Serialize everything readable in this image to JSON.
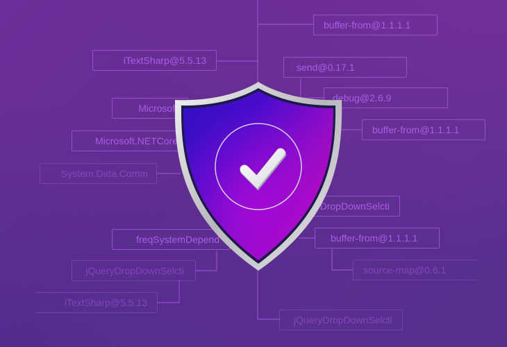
{
  "scene": {
    "description": "Dependency security illustration",
    "colors": {
      "background_top_right": "#7a2f9a",
      "background_bottom_left": "#53308c",
      "node_stroke": "#a95ae6",
      "node_text": "#af5feb",
      "shield_blue": "#3a10c8",
      "shield_magenta": "#c010b8",
      "shield_violet": "#8a10d8",
      "shield_rim": "#d8d8dc",
      "checkmark": "#f0eef2"
    }
  },
  "left_nodes": [
    {
      "label": "iTextSharp@5.5.13"
    },
    {
      "label": "Microsoft"
    },
    {
      "label": "Microsoft.NETCore"
    },
    {
      "label": "System.Data.Comm"
    },
    {
      "label": "freqSystemDepend"
    },
    {
      "label": "jQueryDropDownSelcti"
    },
    {
      "label": "iTextSharp@5.5.13"
    }
  ],
  "right_nodes": [
    {
      "label": "buffer-from@1.1.1.1"
    },
    {
      "label": "send@0.17.1"
    },
    {
      "label": "debug@2.6.9"
    },
    {
      "label": "buffer-from@1.1.1.1"
    },
    {
      "label": "jQueryDropDownSelcti"
    },
    {
      "label": "buffer-from@1.1.1.1"
    },
    {
      "label": "source-map@0.6.1"
    },
    {
      "label": "jQueryDropDownSelcti"
    }
  ],
  "shield": {
    "icon": "shield-check-icon",
    "status": "verified"
  }
}
